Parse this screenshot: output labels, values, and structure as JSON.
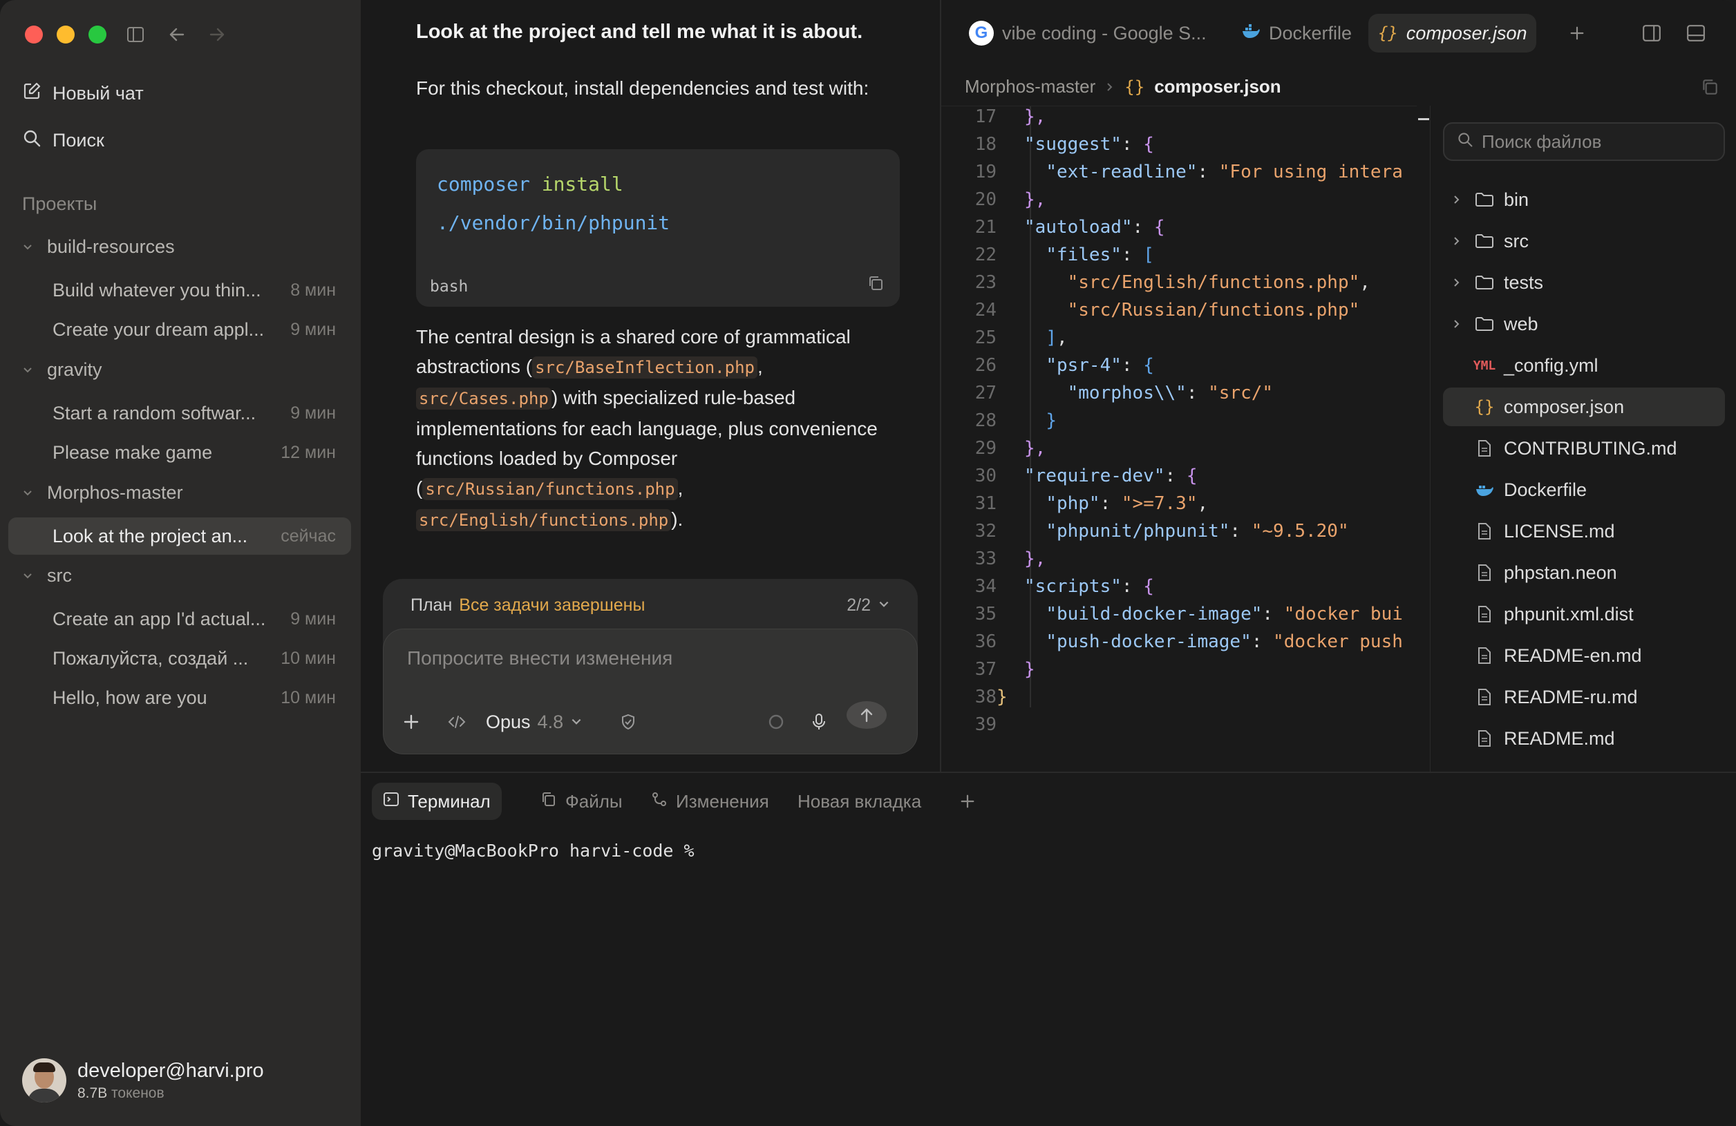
{
  "sidebar": {
    "new_chat": "Новый чат",
    "search": "Поиск",
    "projects_title": "Проекты",
    "projects": [
      {
        "name": "build-resources",
        "chats": [
          {
            "title": "Build whatever you thin...",
            "time": "8 мин"
          },
          {
            "title": "Create your dream appl...",
            "time": "9 мин"
          }
        ]
      },
      {
        "name": "gravity",
        "chats": [
          {
            "title": "Start a random softwar...",
            "time": "9 мин"
          },
          {
            "title": "Please make game",
            "time": "12 мин"
          }
        ]
      },
      {
        "name": "Morphos-master",
        "chats": [
          {
            "title": "Look at the project an...",
            "time": "сейчас"
          }
        ]
      },
      {
        "name": "src",
        "chats": [
          {
            "title": "Create an app I'd actual...",
            "time": "9 мин"
          },
          {
            "title": "Пожалуйста, создай ...",
            "time": "10 мин"
          },
          {
            "title": "Hello, how are you",
            "time": "10 мин"
          }
        ]
      }
    ],
    "user": {
      "email": "developer@harvi.pro",
      "tokens_value": "8.7B",
      "tokens_label": "токенов"
    }
  },
  "chat": {
    "question": "Look at the project and tell me what it is about.",
    "intro": "For this checkout, install dependencies and test with:",
    "code": {
      "line1_cmd": "composer",
      "line1_arg": "install",
      "line2": "./vendor/bin/phpunit",
      "lang": "bash"
    },
    "answer": {
      "t1": "The central design is a shared core of grammatical abstractions (",
      "c1": "src/BaseInflection.php",
      "t2": ",",
      "c2": "src/Cases.php",
      "t3": ") with specialized rule-based implementations for each language, plus convenience functions loaded by Composer (",
      "c3": "src/Russian/functions.php",
      "t4": ",",
      "c4": "src/English/functions.php",
      "t5": ")."
    },
    "plan": {
      "label": "План",
      "status": "Все задачи завершены",
      "count": "2/2"
    },
    "composer": {
      "placeholder": "Попросите внести изменения",
      "model": "Opus",
      "model_version": "4.8"
    }
  },
  "editor": {
    "tabs": [
      {
        "label": "vibe coding - Google S...",
        "icon": "google-icon"
      },
      {
        "label": "Dockerfile",
        "icon": "docker-icon"
      },
      {
        "label": "composer.json",
        "icon": "json-braces-icon"
      }
    ],
    "breadcrumb": {
      "folder": "Morphos-master",
      "file": "composer.json"
    },
    "lines": [
      {
        "n": "17",
        "html": "<span class='p'>},</span>"
      },
      {
        "n": "18",
        "html": "<span class='k'>\"suggest\"</span>: <span class='p'>{</span>"
      },
      {
        "n": "19",
        "html": "  <span class='k'>\"ext-readline\"</span>: <span class='s'>\"For using intera</span>"
      },
      {
        "n": "20",
        "html": "<span class='p'>},</span>"
      },
      {
        "n": "21",
        "html": "<span class='k'>\"autoload\"</span>: <span class='p'>{</span>"
      },
      {
        "n": "22",
        "html": "  <span class='k'>\"files\"</span>: <span class='pb'>[</span>"
      },
      {
        "n": "23",
        "html": "    <span class='s'>\"src/English/functions.php\"</span>,"
      },
      {
        "n": "24",
        "html": "    <span class='s'>\"src/Russian/functions.php\"</span>"
      },
      {
        "n": "25",
        "html": "  <span class='pb'>]</span>,"
      },
      {
        "n": "26",
        "html": "  <span class='k'>\"psr-4\"</span>: <span class='pb'>{</span>"
      },
      {
        "n": "27",
        "html": "    <span class='k'>\"morphos\\\\\"</span>: <span class='s'>\"src/\"</span>"
      },
      {
        "n": "28",
        "html": "  <span class='pb'>}</span>"
      },
      {
        "n": "29",
        "html": "<span class='p'>},</span>"
      },
      {
        "n": "30",
        "html": "<span class='k'>\"require-dev\"</span>: <span class='p'>{</span>"
      },
      {
        "n": "31",
        "html": "  <span class='k'>\"php\"</span>: <span class='s'>\">=7.3\"</span>,"
      },
      {
        "n": "32",
        "html": "  <span class='k'>\"phpunit/phpunit\"</span>: <span class='s'>\"~9.5.20\"</span>"
      },
      {
        "n": "33",
        "html": "<span class='p'>},</span>"
      },
      {
        "n": "34",
        "html": "<span class='k'>\"scripts\"</span>: <span class='p'>{</span>"
      },
      {
        "n": "35",
        "html": "  <span class='k'>\"build-docker-image\"</span>: <span class='s'>\"docker bui</span>"
      },
      {
        "n": "36",
        "html": "  <span class='k'>\"push-docker-image\"</span>: <span class='s'>\"docker push</span>"
      },
      {
        "n": "37",
        "html": "<span class='p'>}</span>"
      },
      {
        "n": "38",
        "html": "<span class='py'>}</span>"
      },
      {
        "n": "39",
        "html": ""
      }
    ],
    "files": {
      "search_placeholder": "Поиск файлов",
      "items": [
        {
          "name": "bin",
          "type": "folder"
        },
        {
          "name": "src",
          "type": "folder"
        },
        {
          "name": "tests",
          "type": "folder"
        },
        {
          "name": "web",
          "type": "folder"
        },
        {
          "name": "_config.yml",
          "type": "yaml"
        },
        {
          "name": "composer.json",
          "type": "json",
          "selected": true
        },
        {
          "name": "CONTRIBUTING.md",
          "type": "file"
        },
        {
          "name": "Dockerfile",
          "type": "docker"
        },
        {
          "name": "LICENSE.md",
          "type": "file"
        },
        {
          "name": "phpstan.neon",
          "type": "file"
        },
        {
          "name": "phpunit.xml.dist",
          "type": "file"
        },
        {
          "name": "README-en.md",
          "type": "file"
        },
        {
          "name": "README-ru.md",
          "type": "file"
        },
        {
          "name": "README.md",
          "type": "file"
        }
      ]
    }
  },
  "terminal": {
    "tabs": [
      "Терминал",
      "Файлы",
      "Изменения",
      "Новая вкладка"
    ],
    "prompt": "gravity@MacBookPro harvi-code %"
  },
  "colors": {
    "accent_orange": "#e2a94c",
    "sidebar_bg": "#2b2a29",
    "editor_bg": "#1a1a1a"
  }
}
